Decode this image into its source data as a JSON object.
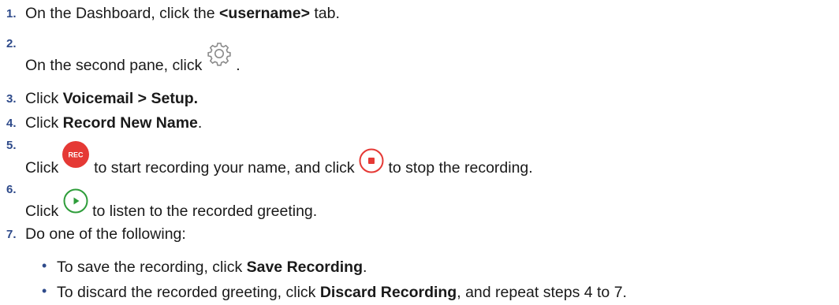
{
  "steps": [
    {
      "num": "1.",
      "pre": "On the Dashboard, click the ",
      "bold": "<username>",
      "post": " tab."
    },
    {
      "num": "2.",
      "pre": "On the second pane, click ",
      "icon": "gear-icon",
      "post": " ."
    },
    {
      "num": "3.",
      "pre": "Click ",
      "bold": "Voicemail > Setup."
    },
    {
      "num": "4.",
      "pre": "Click ",
      "bold": "Record New Name",
      "post": "."
    },
    {
      "num": "5.",
      "pre": "Click ",
      "icon1": "record-icon",
      "icon1_text": "REC",
      "mid": " to start recording your name, and click ",
      "icon2": "stop-icon",
      "post": " to stop the recording."
    },
    {
      "num": "6.",
      "pre": "Click ",
      "icon": "play-icon",
      "post": " to listen to the recorded greeting."
    },
    {
      "num": "7.",
      "pre": "Do one of the following:"
    }
  ],
  "bullets": [
    {
      "pre": "To save the recording, click ",
      "bold": "Save Recording",
      "post": "."
    },
    {
      "pre": "To discard the recorded greeting, click ",
      "bold": "Discard Recording",
      "post": ", and repeat steps 4 to 7."
    }
  ],
  "colors": {
    "number": "#2e4a8a",
    "record_red": "#e53935",
    "play_green": "#2e9d3a"
  }
}
